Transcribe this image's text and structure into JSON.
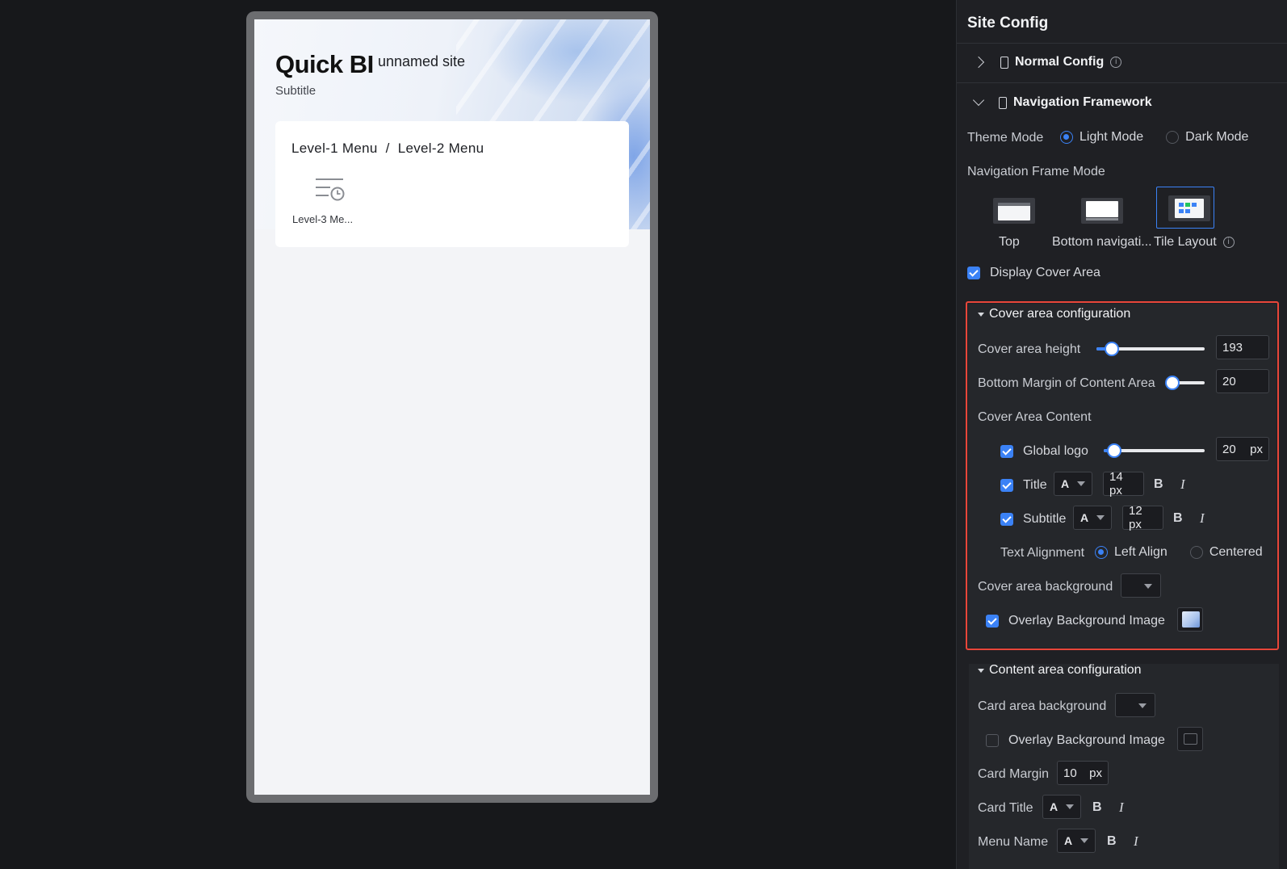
{
  "preview": {
    "logo_text": "Quick BI",
    "site_name": "unnamed site",
    "subtitle": "Subtitle",
    "breadcrumb": "Level-1 Menu  /  Level-2 Menu",
    "menu_item": "Level-3 Me..."
  },
  "panel": {
    "title": "Site Config",
    "normal_config": "Normal Config",
    "navigation_framework": "Navigation Framework",
    "theme_mode": {
      "label": "Theme Mode",
      "options": [
        "Light Mode",
        "Dark Mode"
      ],
      "selected": "Light Mode"
    },
    "nav_frame_mode": {
      "label": "Navigation Frame Mode",
      "options": [
        "Top",
        "Bottom navigati...",
        "Tile Layout"
      ],
      "selected": "Tile Layout"
    },
    "display_cover_area": "Display Cover Area",
    "cover": {
      "heading": "Cover area configuration",
      "height_label": "Cover area height",
      "height_value": "193",
      "height_level": 0.14,
      "bottom_margin_label": "Bottom Margin of Content Area",
      "bottom_margin_value": "20",
      "bottom_margin_level": 0.0,
      "content_label": "Cover Area Content",
      "global_logo_label": "Global logo",
      "global_logo_value": "20",
      "global_logo_level": 0.1,
      "unit": "px",
      "title_label": "Title",
      "title_font": "A",
      "title_size": "14 px",
      "subtitle_label": "Subtitle",
      "subtitle_font": "A",
      "subtitle_size": "12 px",
      "bold": "B",
      "italic": "I",
      "text_alignment": {
        "label": "Text Alignment",
        "options": [
          "Left Align",
          "Centered"
        ],
        "selected": "Left Align"
      },
      "background_label": "Cover area background",
      "overlay_label": "Overlay Background Image"
    },
    "content": {
      "heading": "Content area configuration",
      "card_bg_label": "Card area background",
      "overlay_label": "Overlay Background Image",
      "card_margin_label": "Card Margin",
      "card_margin_value": "10",
      "unit": "px",
      "card_title_label": "Card Title",
      "card_title_font": "A",
      "menu_name_label": "Menu Name",
      "menu_name_font": "A",
      "bold": "B",
      "italic": "I"
    }
  },
  "colors": {
    "accent": "#3b82f6",
    "highlight": "#e8463a",
    "panel_bg": "#1f2024",
    "canvas_bg": "#17181b"
  }
}
